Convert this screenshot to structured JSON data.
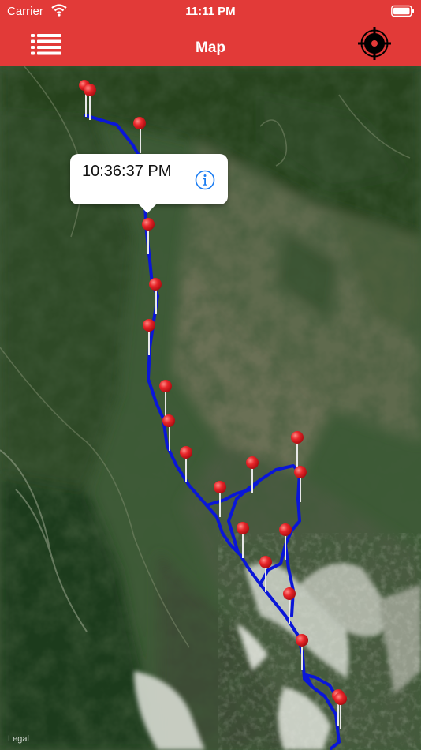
{
  "status_bar": {
    "carrier": "Carrier",
    "time": "11:11 PM"
  },
  "nav": {
    "title": "Map"
  },
  "callout": {
    "time": "10:36:37 PM"
  },
  "map": {
    "legal_label": "Legal",
    "route_color": "#0a16d8",
    "pin_color": "#e8262a"
  },
  "colors": {
    "brand": "#e23a38"
  }
}
